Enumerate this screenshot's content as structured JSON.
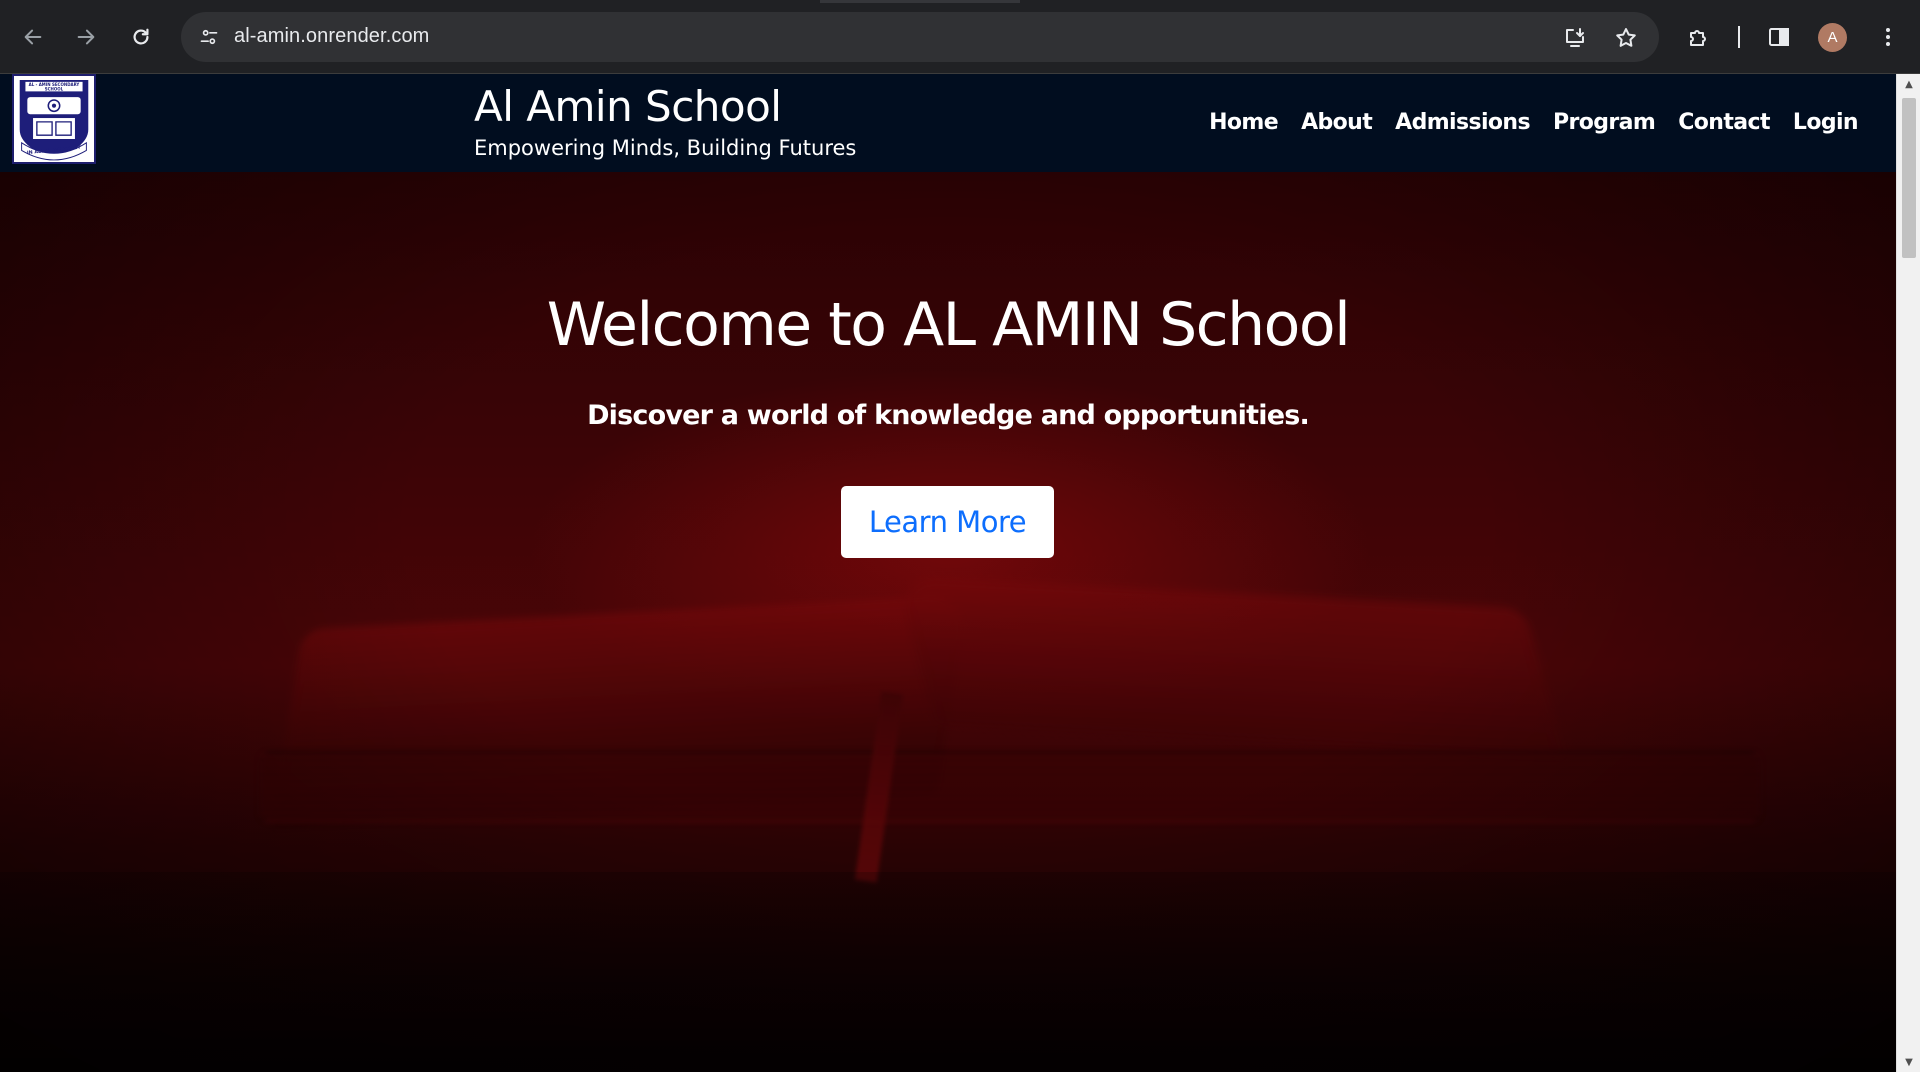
{
  "browser": {
    "url": "al-amin.onrender.com",
    "profile_initial": "A",
    "icons": {
      "back": "back-arrow-icon",
      "forward": "forward-arrow-icon",
      "reload": "reload-icon",
      "site_info": "tune-icon",
      "install": "install-app-icon",
      "bookmark": "star-icon",
      "extensions": "puzzle-icon",
      "side_panel": "side-panel-icon",
      "menu": "kebab-menu-icon"
    }
  },
  "header": {
    "logo_text_top": "AL - AMIN SECONDARY SCHOOL",
    "logo_text_bottom": "IN ALLAH WE TRUST",
    "title": "Al Amin School",
    "tagline": "Empowering Minds, Building Futures",
    "nav": [
      {
        "label": "Home"
      },
      {
        "label": "About"
      },
      {
        "label": "Admissions"
      },
      {
        "label": "Program"
      },
      {
        "label": "Contact"
      },
      {
        "label": "Login"
      }
    ]
  },
  "hero": {
    "title": "Welcome to AL AMIN School",
    "subtitle": "Discover a world of knowledge and opportunities.",
    "cta_label": "Learn More"
  },
  "colors": {
    "header_bg": "#010d1f",
    "hero_tint": "#4a0507",
    "cta_text": "#0d6efd",
    "chrome_bg": "#202124"
  }
}
